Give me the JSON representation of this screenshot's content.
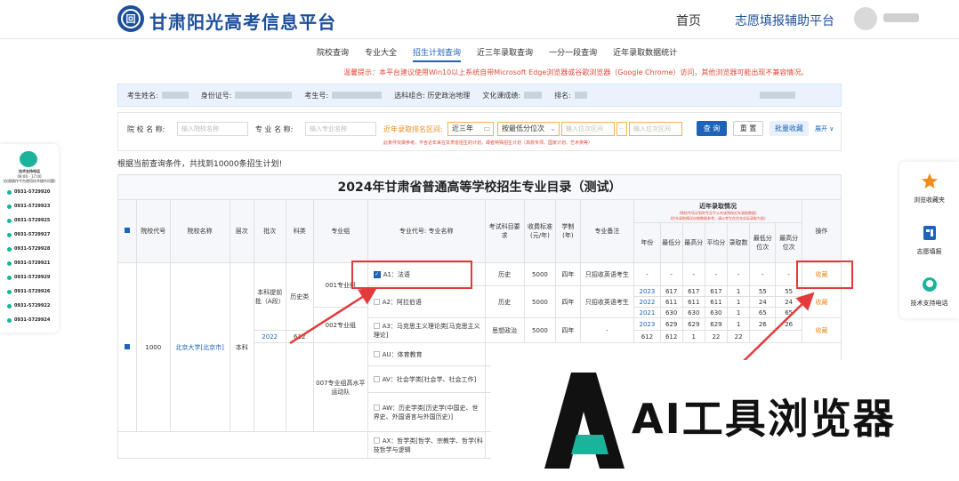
{
  "header": {
    "logo_glyph": "回",
    "brand": "甘肃阳光高考信息平台",
    "nav_home": "首页",
    "nav_aux": "志愿填报辅助平台"
  },
  "subnav": [
    "院校查询",
    "专业大全",
    "招生计划查询",
    "近三年录取查询",
    "一分一段查询",
    "近年录取数据统计"
  ],
  "notice": "温馨提示：本平台建议使用Win10以上系统自带Microsoft Edge浏览器或谷歌浏览器（Google Chrome）访问，其他浏览器可能出现不兼容情况。",
  "userinfo": {
    "name_label": "考生姓名:",
    "id_label": "身份证号:",
    "exam_label": "考生号:",
    "subject_label": "选科组合: 历史政治地理",
    "score_label": "文化课成绩:",
    "rank_label": "排名:"
  },
  "filter": {
    "school_label": "院 校 名 称:",
    "school_placeholder": "输入院校名称",
    "major_label": "专 业 名 称:",
    "major_placeholder": "输入专业名称",
    "rank_label": "近年录取排名区间:",
    "year_select": "近三年",
    "sort_select": "按最低分位次",
    "rank_from_placeholder": "输入位次区间",
    "rank_sep": "--",
    "rank_to_placeholder": "输入位次区间",
    "query": "查 询",
    "reset": "重 置",
    "batch_fav": "批量收藏",
    "expand": "展开 ∨",
    "note": "此条件仅做参考，不含近年来在甘肃省招生的计划，或者特殊招生计划（高校专项、国家计划、艺术类等）"
  },
  "result_text": "根据当前查询条件，共找到10000条招生计划!",
  "table": {
    "title": "2024年甘肃省普通高等学校招生专业目录（测试）",
    "headers": {
      "code": "院校代号",
      "school": "院校名称",
      "level": "层次",
      "batch": "批次",
      "category": "科类",
      "group": "专业组",
      "major": "专业代号: 专业名称",
      "req": "考试科目要求",
      "fee": "收费标准(元/年)",
      "years": "学制(年)",
      "remark": "专业备注",
      "history": "近年录取情况",
      "history_note1": "(院校专项计划的专业不公布该院校近年录取数据)",
      "history_note2": "(往年录取情况仅做数据参考，请以考生在往年实际录取为准)",
      "op": "操作",
      "sub": [
        "年份",
        "最低分",
        "最高分",
        "平均分",
        "录取数",
        "最低分位次",
        "最高分位次"
      ]
    },
    "school": {
      "code": "1000",
      "name": "北京大学[北京市]",
      "level": "本科"
    },
    "batch": "本科提前批（A段）",
    "category": "历史类",
    "group1": "001专业组",
    "group2": "002专业组",
    "group3": "007专业组高水平运动队",
    "rows": [
      {
        "major": "A1：法语",
        "req": "历史",
        "fee": "5000",
        "years": "四年",
        "remark": "只招收英语考生",
        "op": "收藏"
      },
      {
        "major": "A2：阿拉伯语",
        "req": "历史",
        "fee": "5000",
        "years": "四年",
        "remark": "只招收英语考生",
        "op": "收藏"
      },
      {
        "major": "A3：马克思主义理论类[马克思主义理论]",
        "req": "思想政治",
        "fee": "5000",
        "years": "四年",
        "remark": "-",
        "op": "收藏"
      },
      {
        "major": "AU：体育教育"
      },
      {
        "major": "AV：社会学类[社会学、社会工作]"
      },
      {
        "major": "AW：历史学类[历史学(中国史、世界史、外国语言与外国历史)]"
      },
      {
        "major": "AX：哲学类[哲学、宗教学、哲学(科技哲学与逻辑"
      }
    ],
    "history_rows": [
      [
        "-",
        "-",
        "-",
        "-",
        "-",
        "-",
        "-"
      ],
      [
        "2023",
        "617",
        "617",
        "617",
        "1",
        "55",
        "55"
      ],
      [
        "2022",
        "611",
        "611",
        "611",
        "1",
        "24",
        "24"
      ],
      [
        "2021",
        "630",
        "630",
        "630",
        "1",
        "65",
        "65"
      ],
      [
        "2023",
        "629",
        "629",
        "629",
        "1",
        "26",
        "26"
      ],
      [
        "2022",
        "612",
        "612",
        "612",
        "1",
        "22",
        "22"
      ]
    ]
  },
  "left_panel": {
    "title": "技术支持电话",
    "hours": "09:00 - 17:00",
    "sub": "(仅限操作平台使用技术操作问题)",
    "phones": [
      "0931-5729920",
      "0931-5729923",
      "0931-5729925",
      "0931-5729927",
      "0931-5729928",
      "0931-5729921",
      "0931-5729929",
      "0931-5729926",
      "0931-5729922",
      "0931-5729924"
    ]
  },
  "right_panel": {
    "fav": "浏览收藏夹",
    "apply": "志愿填报",
    "support": "技术支持电话"
  },
  "watermark": "AI工具浏览器",
  "colors": {
    "primary": "#1d63b8",
    "brand": "#1d4f9a",
    "warn": "#e24a3b",
    "accent": "#f08c1a"
  }
}
